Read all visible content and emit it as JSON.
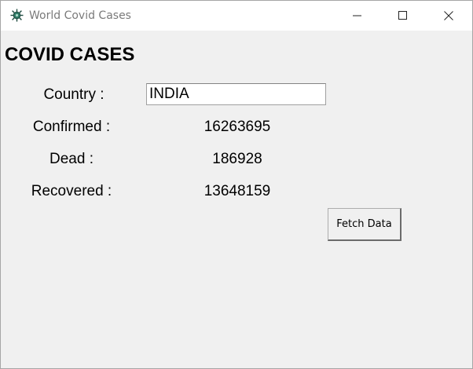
{
  "window": {
    "title": "World Covid Cases",
    "icon": "virus-icon"
  },
  "main": {
    "heading": "COVID CASES",
    "country_label": "Country :",
    "country_value": "INDIA",
    "confirmed_label": "Confirmed :",
    "confirmed_value": "16263695",
    "dead_label": "Dead :",
    "dead_value": "186928",
    "recovered_label": "Recovered :",
    "recovered_value": "13648159",
    "fetch_button_label": "Fetch Data"
  }
}
